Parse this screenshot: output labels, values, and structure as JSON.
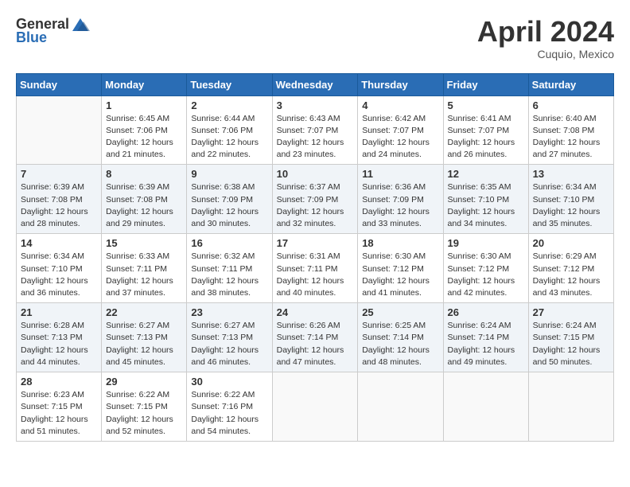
{
  "header": {
    "logo_general": "General",
    "logo_blue": "Blue",
    "month": "April 2024",
    "location": "Cuquio, Mexico"
  },
  "columns": [
    "Sunday",
    "Monday",
    "Tuesday",
    "Wednesday",
    "Thursday",
    "Friday",
    "Saturday"
  ],
  "weeks": [
    [
      {
        "day": "",
        "info": ""
      },
      {
        "day": "1",
        "info": "Sunrise: 6:45 AM\nSunset: 7:06 PM\nDaylight: 12 hours\nand 21 minutes."
      },
      {
        "day": "2",
        "info": "Sunrise: 6:44 AM\nSunset: 7:06 PM\nDaylight: 12 hours\nand 22 minutes."
      },
      {
        "day": "3",
        "info": "Sunrise: 6:43 AM\nSunset: 7:07 PM\nDaylight: 12 hours\nand 23 minutes."
      },
      {
        "day": "4",
        "info": "Sunrise: 6:42 AM\nSunset: 7:07 PM\nDaylight: 12 hours\nand 24 minutes."
      },
      {
        "day": "5",
        "info": "Sunrise: 6:41 AM\nSunset: 7:07 PM\nDaylight: 12 hours\nand 26 minutes."
      },
      {
        "day": "6",
        "info": "Sunrise: 6:40 AM\nSunset: 7:08 PM\nDaylight: 12 hours\nand 27 minutes."
      }
    ],
    [
      {
        "day": "7",
        "info": "Sunrise: 6:39 AM\nSunset: 7:08 PM\nDaylight: 12 hours\nand 28 minutes."
      },
      {
        "day": "8",
        "info": "Sunrise: 6:39 AM\nSunset: 7:08 PM\nDaylight: 12 hours\nand 29 minutes."
      },
      {
        "day": "9",
        "info": "Sunrise: 6:38 AM\nSunset: 7:09 PM\nDaylight: 12 hours\nand 30 minutes."
      },
      {
        "day": "10",
        "info": "Sunrise: 6:37 AM\nSunset: 7:09 PM\nDaylight: 12 hours\nand 32 minutes."
      },
      {
        "day": "11",
        "info": "Sunrise: 6:36 AM\nSunset: 7:09 PM\nDaylight: 12 hours\nand 33 minutes."
      },
      {
        "day": "12",
        "info": "Sunrise: 6:35 AM\nSunset: 7:10 PM\nDaylight: 12 hours\nand 34 minutes."
      },
      {
        "day": "13",
        "info": "Sunrise: 6:34 AM\nSunset: 7:10 PM\nDaylight: 12 hours\nand 35 minutes."
      }
    ],
    [
      {
        "day": "14",
        "info": "Sunrise: 6:34 AM\nSunset: 7:10 PM\nDaylight: 12 hours\nand 36 minutes."
      },
      {
        "day": "15",
        "info": "Sunrise: 6:33 AM\nSunset: 7:11 PM\nDaylight: 12 hours\nand 37 minutes."
      },
      {
        "day": "16",
        "info": "Sunrise: 6:32 AM\nSunset: 7:11 PM\nDaylight: 12 hours\nand 38 minutes."
      },
      {
        "day": "17",
        "info": "Sunrise: 6:31 AM\nSunset: 7:11 PM\nDaylight: 12 hours\nand 40 minutes."
      },
      {
        "day": "18",
        "info": "Sunrise: 6:30 AM\nSunset: 7:12 PM\nDaylight: 12 hours\nand 41 minutes."
      },
      {
        "day": "19",
        "info": "Sunrise: 6:30 AM\nSunset: 7:12 PM\nDaylight: 12 hours\nand 42 minutes."
      },
      {
        "day": "20",
        "info": "Sunrise: 6:29 AM\nSunset: 7:12 PM\nDaylight: 12 hours\nand 43 minutes."
      }
    ],
    [
      {
        "day": "21",
        "info": "Sunrise: 6:28 AM\nSunset: 7:13 PM\nDaylight: 12 hours\nand 44 minutes."
      },
      {
        "day": "22",
        "info": "Sunrise: 6:27 AM\nSunset: 7:13 PM\nDaylight: 12 hours\nand 45 minutes."
      },
      {
        "day": "23",
        "info": "Sunrise: 6:27 AM\nSunset: 7:13 PM\nDaylight: 12 hours\nand 46 minutes."
      },
      {
        "day": "24",
        "info": "Sunrise: 6:26 AM\nSunset: 7:14 PM\nDaylight: 12 hours\nand 47 minutes."
      },
      {
        "day": "25",
        "info": "Sunrise: 6:25 AM\nSunset: 7:14 PM\nDaylight: 12 hours\nand 48 minutes."
      },
      {
        "day": "26",
        "info": "Sunrise: 6:24 AM\nSunset: 7:14 PM\nDaylight: 12 hours\nand 49 minutes."
      },
      {
        "day": "27",
        "info": "Sunrise: 6:24 AM\nSunset: 7:15 PM\nDaylight: 12 hours\nand 50 minutes."
      }
    ],
    [
      {
        "day": "28",
        "info": "Sunrise: 6:23 AM\nSunset: 7:15 PM\nDaylight: 12 hours\nand 51 minutes."
      },
      {
        "day": "29",
        "info": "Sunrise: 6:22 AM\nSunset: 7:15 PM\nDaylight: 12 hours\nand 52 minutes."
      },
      {
        "day": "30",
        "info": "Sunrise: 6:22 AM\nSunset: 7:16 PM\nDaylight: 12 hours\nand 54 minutes."
      },
      {
        "day": "",
        "info": ""
      },
      {
        "day": "",
        "info": ""
      },
      {
        "day": "",
        "info": ""
      },
      {
        "day": "",
        "info": ""
      }
    ]
  ]
}
